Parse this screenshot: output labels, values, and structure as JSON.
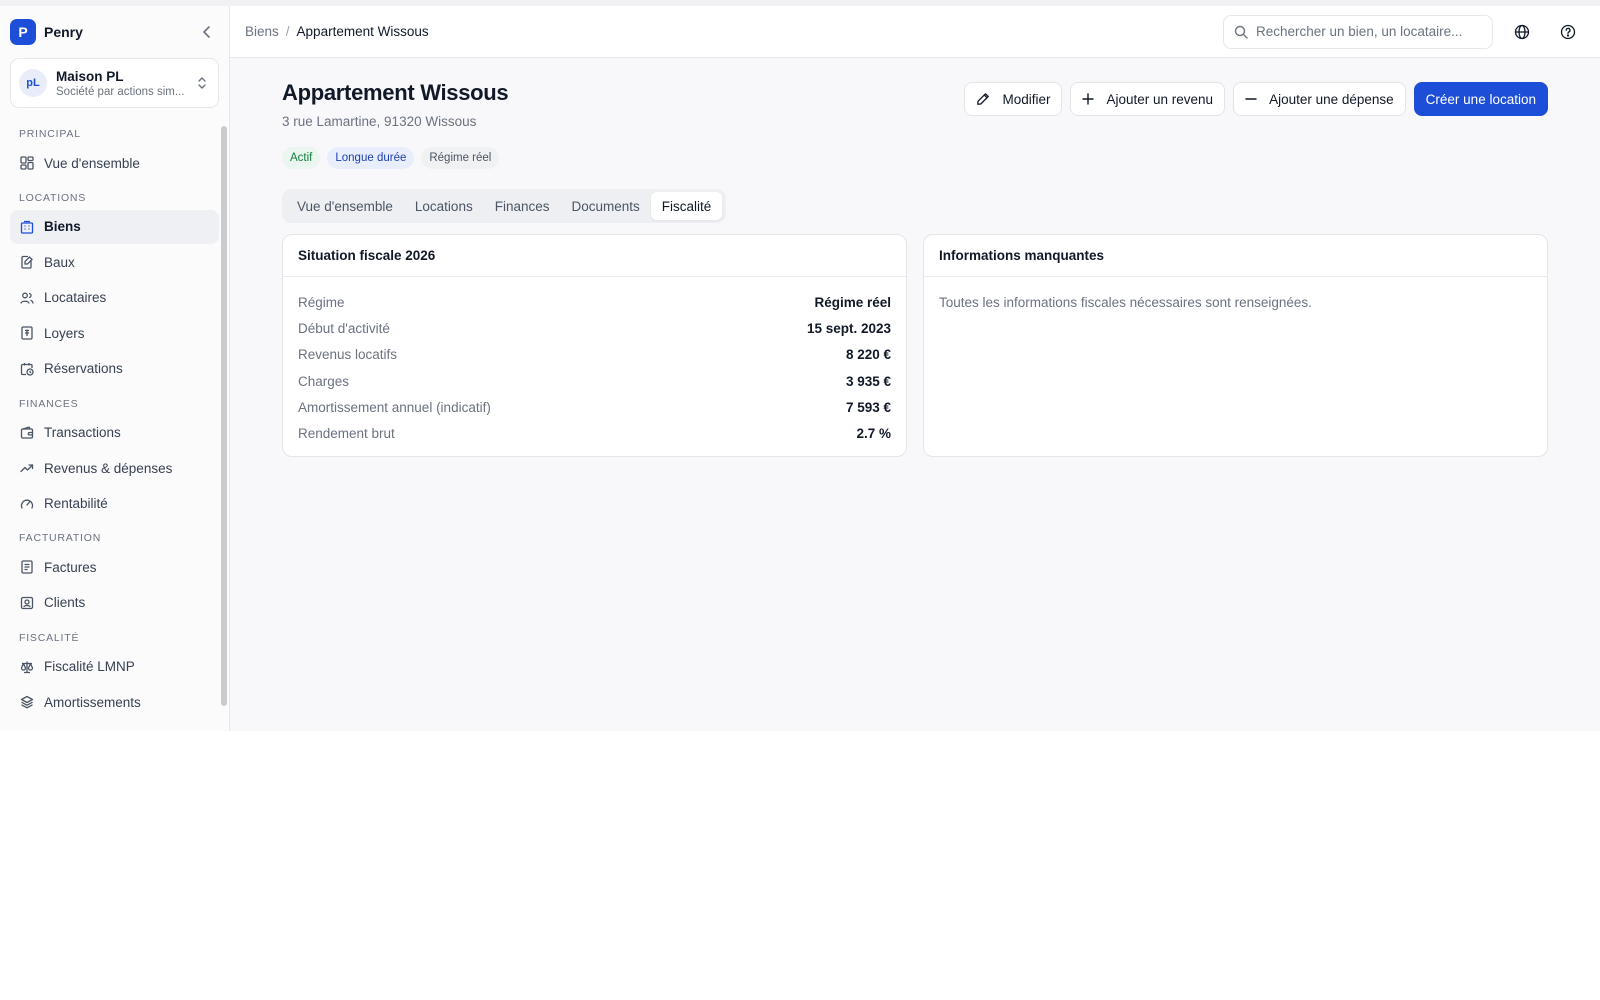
{
  "brand": {
    "logo_letter": "P",
    "name": "Penry"
  },
  "org": {
    "avatar": "pL",
    "name": "Maison PL",
    "subtitle": "Société par actions sim..."
  },
  "sidebar": {
    "sections": [
      {
        "label": "PRINCIPAL",
        "items": [
          {
            "label": "Vue d'ensemble",
            "icon": "dashboard-icon"
          }
        ]
      },
      {
        "label": "LOCATIONS",
        "items": [
          {
            "label": "Biens",
            "icon": "building-icon",
            "active": true
          },
          {
            "label": "Baux",
            "icon": "document-edit-icon"
          },
          {
            "label": "Locataires",
            "icon": "users-icon"
          },
          {
            "label": "Loyers",
            "icon": "receipt-icon"
          },
          {
            "label": "Réservations",
            "icon": "calendar-clock-icon"
          }
        ]
      },
      {
        "label": "FINANCES",
        "items": [
          {
            "label": "Transactions",
            "icon": "wallet-icon"
          },
          {
            "label": "Revenus & dépenses",
            "icon": "trend-up-icon"
          },
          {
            "label": "Rentabilité",
            "icon": "gauge-icon"
          }
        ]
      },
      {
        "label": "FACTURATION",
        "items": [
          {
            "label": "Factures",
            "icon": "invoice-icon"
          },
          {
            "label": "Clients",
            "icon": "contact-icon"
          }
        ]
      },
      {
        "label": "FISCALITÉ",
        "items": [
          {
            "label": "Fiscalité LMNP",
            "icon": "scale-icon"
          },
          {
            "label": "Amortissements",
            "icon": "layers-icon"
          }
        ]
      }
    ]
  },
  "topbar": {
    "breadcrumb": {
      "parent": "Biens",
      "separator": "/",
      "current": "Appartement Wissous"
    },
    "search_placeholder": "Rechercher un bien, un locataire..."
  },
  "property": {
    "title": "Appartement Wissous",
    "address": "3 rue Lamartine, 91320 Wissous",
    "badges": [
      {
        "label": "Actif",
        "tone": "green"
      },
      {
        "label": "Longue durée",
        "tone": "blue"
      },
      {
        "label": "Régime réel",
        "tone": "gray"
      }
    ]
  },
  "actions": {
    "edit": "Modifier",
    "add_income": "Ajouter un revenu",
    "add_expense": "Ajouter une dépense",
    "create_rental": "Créer une location"
  },
  "tabs": [
    {
      "label": "Vue d'ensemble"
    },
    {
      "label": "Locations"
    },
    {
      "label": "Finances"
    },
    {
      "label": "Documents"
    },
    {
      "label": "Fiscalité",
      "active": true
    }
  ],
  "tax_card": {
    "title": "Situation fiscale 2026",
    "rows": [
      {
        "label": "Régime",
        "value": "Régime réel"
      },
      {
        "label": "Début d'activité",
        "value": "15 sept. 2023"
      },
      {
        "label": "Revenus locatifs",
        "value": "8 220 €"
      },
      {
        "label": "Charges",
        "value": "3 935 €"
      },
      {
        "label": "Amortissement annuel (indicatif)",
        "value": "7 593 €"
      },
      {
        "label": "Rendement brut",
        "value": "2.7 %"
      }
    ]
  },
  "missing_card": {
    "title": "Informations manquantes",
    "message": "Toutes les informations fiscales nécessaires sont renseignées."
  },
  "colors": {
    "primary": "#1d4ed8",
    "badge_green": "#15803d",
    "badge_blue": "#1e40af"
  }
}
